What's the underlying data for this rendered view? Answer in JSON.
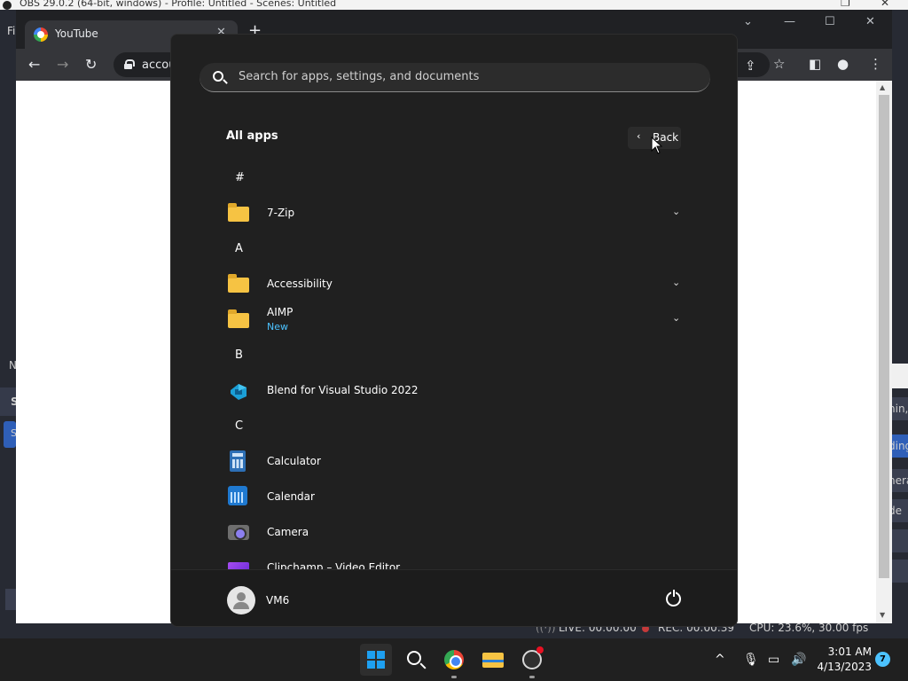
{
  "obs": {
    "title": "OBS 29.0.2 (64-bit, windows) - Profile: Untitled - Scenes: Untitled",
    "menu_first": "Fi",
    "side_n": "N",
    "side_s": "S",
    "side_s2": "S",
    "right_fragments": [
      "nin,",
      "ding",
      "nera",
      "de"
    ],
    "status_live": "LIVE: 00:00:00",
    "status_rec": "REC: 00:00:39",
    "status_cpu": "CPU: 23.6%, 30.00 fps"
  },
  "chrome": {
    "tab_title": "YouTube",
    "tab_close": "✕",
    "new_tab": "+",
    "address_text": "accou",
    "window_controls": [
      "⌄",
      "—",
      "☐",
      "✕"
    ]
  },
  "start_menu": {
    "search_placeholder": "Search for apps, settings, and documents",
    "heading": "All apps",
    "back_label": "Back",
    "sections": [
      {
        "letter": "#"
      },
      {
        "letter": "A"
      },
      {
        "letter": "B"
      },
      {
        "letter": "C"
      }
    ],
    "apps": {
      "zip": {
        "name": "7-Zip",
        "icon": "folder-icon"
      },
      "accessibility": {
        "name": "Accessibility",
        "icon": "folder-icon"
      },
      "aimp": {
        "name": "AIMP",
        "badge": "New",
        "icon": "folder-icon"
      },
      "blend": {
        "name": "Blend for Visual Studio 2022",
        "icon": "blend-icon"
      },
      "calculator": {
        "name": "Calculator",
        "icon": "calculator-icon"
      },
      "calendar": {
        "name": "Calendar",
        "icon": "calendar-icon"
      },
      "camera": {
        "name": "Camera",
        "icon": "camera-icon"
      },
      "clipchamp": {
        "name": "Clipchamp – Video Editor",
        "icon": "clipchamp-icon"
      }
    },
    "user": {
      "name": "VM6"
    }
  },
  "taskbar": {
    "time": "3:01 AM",
    "date": "4/13/2023",
    "notification_count": "7",
    "pinned": [
      "start-icon",
      "search-icon",
      "chrome-icon",
      "file-explorer-icon",
      "obs-icon"
    ]
  },
  "colors": {
    "accent": "#4cc2ff",
    "start_bg": "#202020",
    "taskbar_bg": "#202020"
  }
}
